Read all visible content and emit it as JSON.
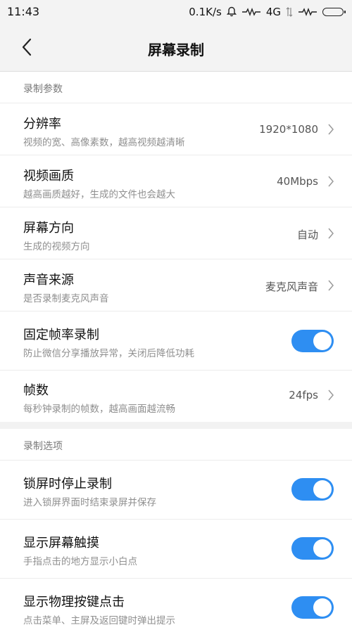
{
  "status_bar": {
    "time": "11:43",
    "network_speed": "0.1K/s",
    "network_type": "4G",
    "icons": [
      "bell-icon",
      "activity-icon",
      "signal-icon",
      "battery-icon"
    ]
  },
  "header": {
    "title": "屏幕录制",
    "back_icon": "chevron-left-icon"
  },
  "sections": [
    {
      "header": "录制参数",
      "rows": [
        {
          "title": "分辨率",
          "subtitle": "视频的宽、高像素数，越高视频越清晰",
          "value": "1920*1080"
        },
        {
          "title": "视频画质",
          "subtitle": "越高画质越好，生成的文件也会越大",
          "value": "40Mbps"
        },
        {
          "title": "屏幕方向",
          "subtitle": "生成的视频方向",
          "value": "自动"
        },
        {
          "title": "声音来源",
          "subtitle": "是否录制麦克风声音",
          "value": "麦克风声音"
        },
        {
          "title": "固定帧率录制",
          "subtitle": "防止微信分享播放异常，关闭后降低功耗",
          "toggle": true
        },
        {
          "title": "帧数",
          "subtitle": "每秒钟录制的帧数，越高画面越流畅",
          "value": "24fps"
        }
      ]
    },
    {
      "header": "录制选项",
      "rows": [
        {
          "title": "锁屏时停止录制",
          "subtitle": "进入锁屏界面时结束录屏并保存",
          "toggle": true
        },
        {
          "title": "显示屏幕触摸",
          "subtitle": "手指点击的地方显示小白点",
          "toggle": true
        },
        {
          "title": "显示物理按键点击",
          "subtitle": "点击菜单、主屏及返回键时弹出提示",
          "toggle": true
        }
      ]
    }
  ],
  "colors": {
    "accent": "#2e8ef2",
    "background": "#f3f3f3"
  }
}
